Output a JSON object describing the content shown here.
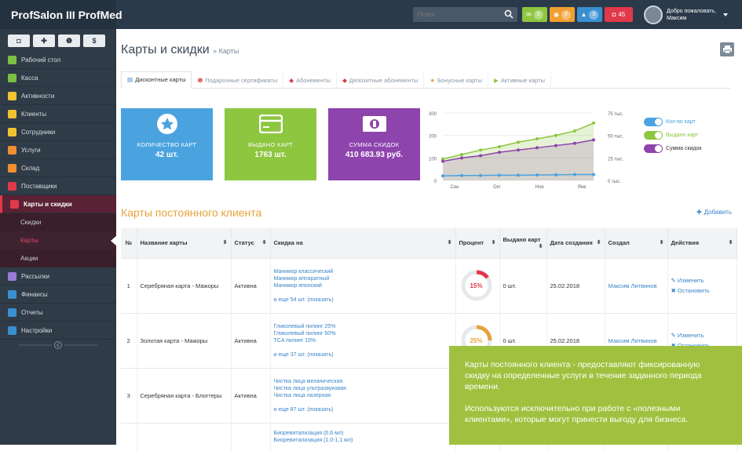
{
  "app": {
    "title": "ProfSalon III ProfMed"
  },
  "topbar": {
    "search": {
      "placeholder": "Поиск"
    },
    "badges": [
      {
        "icon": "envelope-icon",
        "count": "0",
        "color": "#8dc63f"
      },
      {
        "icon": "warning-icon",
        "count": "0",
        "color": "#f0a030"
      },
      {
        "icon": "bell-icon",
        "count": "0",
        "color": "#3a8fd0"
      },
      {
        "icon": "alert-icon",
        "count": "45",
        "color": "#e0394a"
      }
    ],
    "user": {
      "greeting": "Добро пожаловать,",
      "name": "Максим"
    }
  },
  "sidebar": {
    "quick_buttons": [
      "◘",
      "✚",
      "❶",
      "$"
    ],
    "items": [
      {
        "label": "Рабочий стол",
        "icon": "home-icon",
        "color": "#7ac143"
      },
      {
        "label": "Касса",
        "icon": "dollar-icon",
        "color": "#7ac143"
      },
      {
        "label": "Активности",
        "icon": "bell-icon",
        "color": "#f0c330"
      },
      {
        "label": "Клиенты",
        "icon": "users-icon",
        "color": "#f0c330"
      },
      {
        "label": "Сотрудники",
        "icon": "user-icon",
        "color": "#f0c330"
      },
      {
        "label": "Услуги",
        "icon": "scissors-icon",
        "color": "#f09030"
      },
      {
        "label": "Склад",
        "icon": "box-icon",
        "color": "#f09030"
      },
      {
        "label": "Поставщики",
        "icon": "truck-icon",
        "color": "#e0394a"
      },
      {
        "label": "Карты и скидки",
        "icon": "card-icon",
        "color": "#e0394a"
      }
    ],
    "subitems": [
      "Скидки",
      "Карты",
      "Акции"
    ],
    "items_after": [
      {
        "label": "Рассылки",
        "icon": "mail-icon",
        "color": "#9b7bd6"
      },
      {
        "label": "Финансы",
        "icon": "money-icon",
        "color": "#3a8fd0"
      },
      {
        "label": "Отчеты",
        "icon": "report-icon",
        "color": "#3a8fd0"
      },
      {
        "label": "Настройки",
        "icon": "gear-icon",
        "color": "#3a8fd0"
      }
    ]
  },
  "page": {
    "title": "Карты и скидки",
    "breadcrumb": "» Карты"
  },
  "tabs": [
    {
      "label": "Дисконтные карты",
      "active": true
    },
    {
      "label": "Подарочные сертификаты"
    },
    {
      "label": "Абонементы"
    },
    {
      "label": "Депозитные абонементы"
    },
    {
      "label": "Бонусные карты"
    },
    {
      "label": "Активные карты"
    }
  ],
  "stats": [
    {
      "label": "Количество карт",
      "value": "42 шт.",
      "color": "#4aa3df"
    },
    {
      "label": "Выдано карт",
      "value": "1763 шт.",
      "color": "#8dc63f"
    },
    {
      "label": "Сумма скидок",
      "value": "410 683.93 руб.",
      "color": "#8e44ad"
    }
  ],
  "chart_data": {
    "type": "line",
    "categories": [
      "Сен",
      "Окт",
      "Ноя",
      "Янв"
    ],
    "left_ticks": [
      "300",
      "200",
      "100",
      "0"
    ],
    "right_ticks": [
      "75 тыс.",
      "50 тыс.",
      "25 тыс.",
      "0 тыс."
    ],
    "ylim_left": [
      0,
      300
    ],
    "series": [
      {
        "name": "Кол-во карт",
        "color": "#4aa3df",
        "values": [
          20,
          22,
          22,
          23,
          23,
          24,
          25,
          26,
          26
        ]
      },
      {
        "name": "Выдано карт",
        "color": "#8dc63f",
        "values": [
          95,
          115,
          135,
          150,
          170,
          185,
          200,
          220,
          255
        ]
      },
      {
        "name": "Сумма скидок",
        "color": "#8e44ad",
        "values": [
          85,
          100,
          110,
          125,
          135,
          145,
          155,
          165,
          180
        ]
      }
    ]
  },
  "section": {
    "title": "Карты постоянного клиента",
    "add_label": "Добавить"
  },
  "table": {
    "headers": [
      "№",
      "Название карты",
      "Статус",
      "Скидка на",
      "Процент",
      "Выдано карт",
      "Дата создания",
      "Создал",
      "Действия"
    ],
    "rows": [
      {
        "num": "1",
        "name": "Серебряная карта - Мажоры",
        "status": "Активна",
        "disc": [
          "Маникюр классический",
          "Маникюр аппаратный",
          "Маникюр японский"
        ],
        "more": "и еще 54 шт. (показать)",
        "percent": 15,
        "percent_label": "15%",
        "percent_color": "#e0394a",
        "issued": "0 шт.",
        "date": "25.02.2018",
        "creator": "Максим Литвинов",
        "edit": "Изменить",
        "stop": "Остановить"
      },
      {
        "num": "2",
        "name": "Золотая карта - Мажоры",
        "status": "Активна",
        "disc": [
          "Гликолевый пилинг 25%",
          "Гликолевый пилинг 50%",
          "TCA пилинг 15%"
        ],
        "more": "и еще 37 шт. (показать)",
        "percent": 25,
        "percent_label": "25%",
        "percent_color": "#e8a23c",
        "issued": "0 шт.",
        "date": "25.02.2018",
        "creator": "Максим Литвинов",
        "edit": "Изменить",
        "stop": "Остановить"
      },
      {
        "num": "3",
        "name": "Серебряная карта - Блогтеры",
        "status": "Активна",
        "disc": [
          "Чистка лица механическая",
          "Чистка лица ультразвуковая",
          "Чистка лица лазерная"
        ],
        "more": "и еще 87 шт. (показать)",
        "percent": 0,
        "percent_label": "",
        "percent_color": "#e0394a",
        "issued": "",
        "date": "",
        "creator": "",
        "edit": "",
        "stop": ""
      },
      {
        "num": "",
        "name": "",
        "status": "",
        "disc": [
          "Биоревитализация (0,6 мл)",
          "Биоревитализация (1,0-1,1 мл)"
        ],
        "more": "",
        "percent": 0,
        "percent_label": "",
        "percent_color": "#e0394a",
        "issued": "",
        "date": "",
        "creator": "",
        "edit": "",
        "stop": ""
      }
    ]
  },
  "tooltip": {
    "p1": "Карты постоянного клиента - предоставляют фиксированную скидку на определенные услуги в течение заданного периода времени.",
    "p2": "Используются исключительно при работе с «полезными клиентами», которые могут принести выгоду для бизнеса."
  }
}
